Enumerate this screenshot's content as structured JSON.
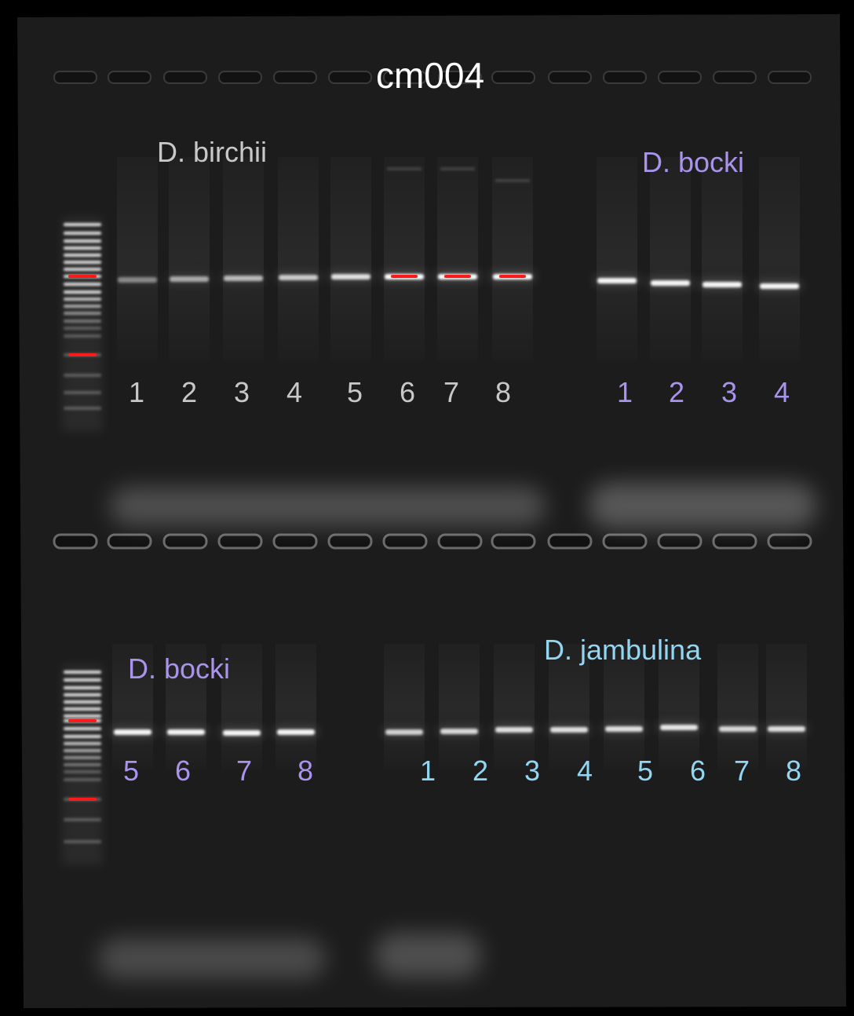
{
  "title": "cm004",
  "colors": {
    "background": "#000000",
    "gel": "#1c1c1c",
    "title": "#ffffff",
    "birchii": "#c8c8c8",
    "bocki": "#a993ec",
    "jambulina": "#93d6f2",
    "saturated_band": "#ff1a1a"
  },
  "top_row": {
    "groups": [
      {
        "species": "D. birchii",
        "color_key": "birchii",
        "lanes": [
          "1",
          "2",
          "3",
          "4",
          "5",
          "6",
          "7",
          "8"
        ]
      },
      {
        "species": "D. bocki",
        "color_key": "bocki",
        "lanes": [
          "1",
          "2",
          "3",
          "4"
        ]
      }
    ]
  },
  "bottom_row": {
    "groups": [
      {
        "species": "D. bocki",
        "color_key": "bocki",
        "lanes": [
          "5",
          "6",
          "7",
          "8"
        ]
      },
      {
        "species": "D. jambulina",
        "color_key": "jambulina",
        "lanes": [
          "1",
          "2",
          "3",
          "4",
          "5",
          "6",
          "7",
          "8"
        ]
      }
    ]
  },
  "band_intensity": {
    "top": [
      0.25,
      0.45,
      0.55,
      0.65,
      0.8,
      1.0,
      1.0,
      1.0,
      0.95,
      0.95,
      0.95,
      0.95
    ],
    "bottom": [
      0.95,
      0.95,
      0.95,
      0.95,
      0.7,
      0.75,
      0.8,
      0.8,
      0.8,
      0.85,
      0.75,
      0.8
    ]
  }
}
